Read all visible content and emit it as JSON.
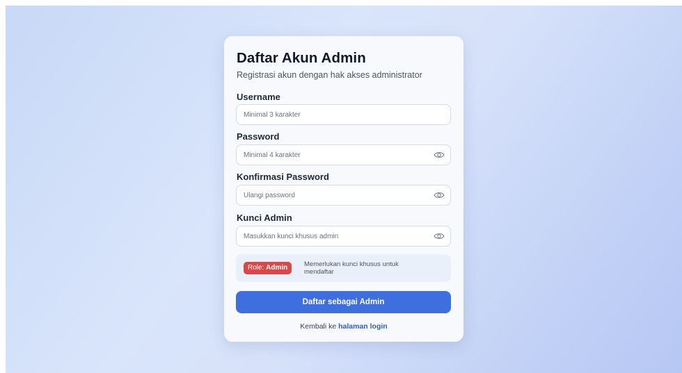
{
  "form": {
    "title": "Daftar Akun Admin",
    "subtitle": "Registrasi akun dengan hak akses administrator",
    "fields": [
      {
        "label": "Username",
        "placeholder": "Minimal 3 karakter",
        "value": "",
        "has_visibility_toggle": false
      },
      {
        "label": "Password",
        "placeholder": "Minimal 4 karakter",
        "value": "",
        "has_visibility_toggle": true,
        "toggle_icon": "eye-icon"
      },
      {
        "label": "Konfirmasi Password",
        "placeholder": "Ulangi password",
        "value": "",
        "has_visibility_toggle": true,
        "toggle_icon": "eye-icon"
      },
      {
        "label": "Kunci Admin",
        "placeholder": "Masukkan kunci khusus admin",
        "value": "",
        "has_visibility_toggle": true,
        "toggle_icon": "eye-icon"
      }
    ],
    "role": {
      "prefix": "Role: ",
      "value": "Admin",
      "description": "Memerlukan kunci khusus untuk mendaftar",
      "badge_color": "#d94848",
      "box_color": "#eaf0fa"
    },
    "submit_label": "Daftar sebagai Admin",
    "back_text": "Kembali ke ",
    "back_link": "halaman login"
  },
  "colors": {
    "accent": "#3f6fde",
    "link": "#2f5fc4",
    "background_start": "#c8d8f6",
    "background_end": "#b6c7f3",
    "card": "#f7f9fd"
  }
}
